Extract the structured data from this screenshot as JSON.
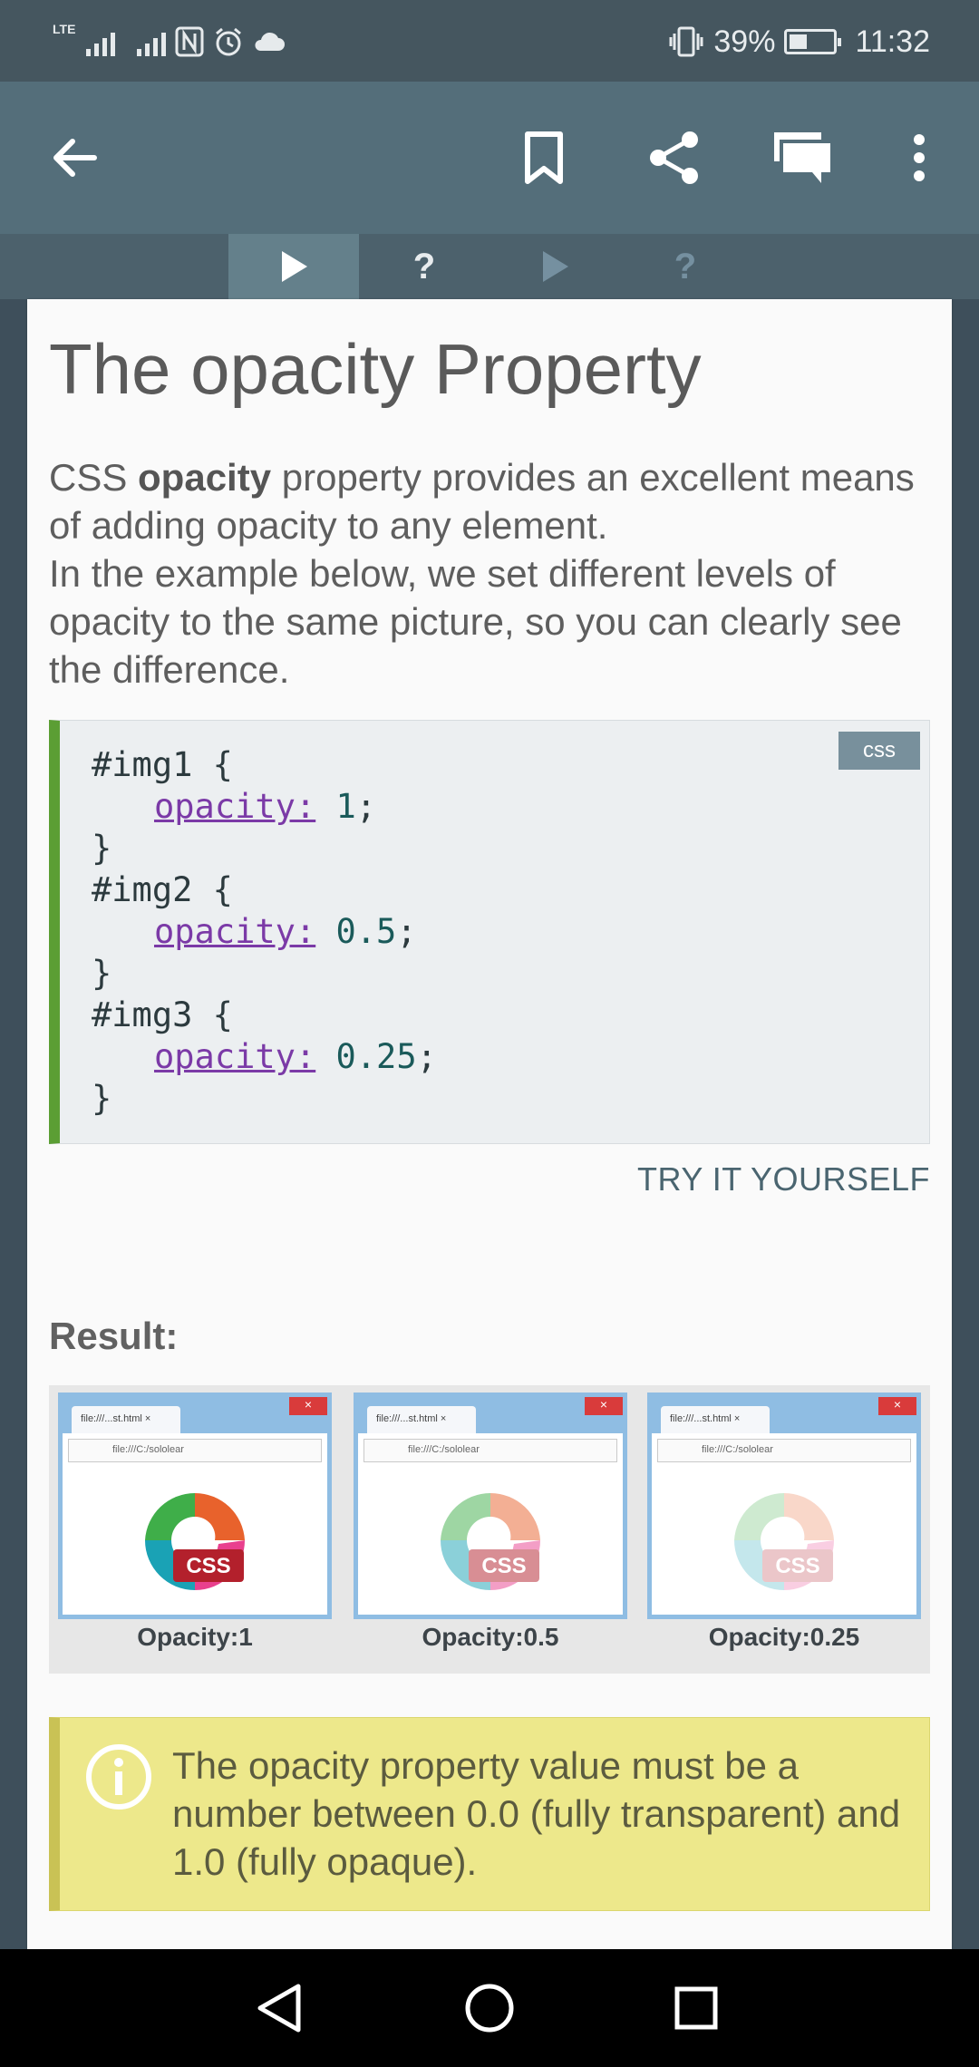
{
  "status_bar": {
    "network": "LTE",
    "battery": "39%",
    "battery_level": 0.39,
    "time": "11:32",
    "icons": [
      "signal-icon",
      "signal-icon",
      "nfc-icon",
      "alarm-icon",
      "cloud-icon",
      "vibrate-icon",
      "battery-icon"
    ]
  },
  "app_bar": {
    "icons": [
      "back-arrow-icon",
      "bookmark-icon",
      "share-icon",
      "comments-icon",
      "more-vert-icon"
    ]
  },
  "lesson_tabs": [
    {
      "icon": "play-icon",
      "active": true
    },
    {
      "label": "?",
      "active": false
    },
    {
      "icon": "play-icon",
      "active": false
    },
    {
      "label": "?",
      "active": false
    }
  ],
  "lesson": {
    "title": "The opacity Property",
    "intro_before_bold": "CSS ",
    "intro_bold": "opacity",
    "intro_after_bold": " property provides an excellent means of adding opacity to any element.",
    "intro_line2": "In the example below, we set different levels of opacity to the same picture, so you can clearly see the difference."
  },
  "code": {
    "language": "css",
    "lines": [
      {
        "type": "selector",
        "text": "#img1 {"
      },
      {
        "type": "prop",
        "prop": "opacity:",
        "value": " 1",
        "end": ";"
      },
      {
        "type": "close",
        "text": "}"
      },
      {
        "type": "selector",
        "text": "#img2 {"
      },
      {
        "type": "prop",
        "prop": "opacity:",
        "value": " 0.5",
        "end": ";"
      },
      {
        "type": "close",
        "text": "}"
      },
      {
        "type": "selector",
        "text": "#img3 {"
      },
      {
        "type": "prop",
        "prop": "opacity:",
        "value": " 0.25",
        "end": ";"
      },
      {
        "type": "close",
        "text": "}"
      }
    ]
  },
  "try_button": "TRY IT YOURSELF",
  "result": {
    "label": "Result:",
    "images": [
      {
        "tab": "file:///...st.html  ×",
        "url": "file:///C:/sololear",
        "badge": "CSS",
        "caption": "Opacity:1",
        "opacity": 1
      },
      {
        "tab": "file:///...st.html  ×",
        "url": "file:///C:/sololear",
        "badge": "CSS",
        "caption": "Opacity:0.5",
        "opacity": 0.5
      },
      {
        "tab": "file:///...st.html  ×",
        "url": "file:///C:/sololear",
        "badge": "CSS",
        "caption": "Opacity:0.25",
        "opacity": 0.25
      }
    ]
  },
  "note": {
    "icon": "info-icon",
    "text": "The opacity property value must be a number between 0.0 (fully transparent) and 1.0 (fully opaque)."
  },
  "nav_bar": {
    "icons": [
      "back-triangle-icon",
      "home-circle-icon",
      "recents-square-icon"
    ]
  },
  "colors": {
    "app_bar": "#546e7a",
    "code_accent": "#5b9e34",
    "note_bg": "#ede88b",
    "keyword": "#7b3aa7"
  }
}
